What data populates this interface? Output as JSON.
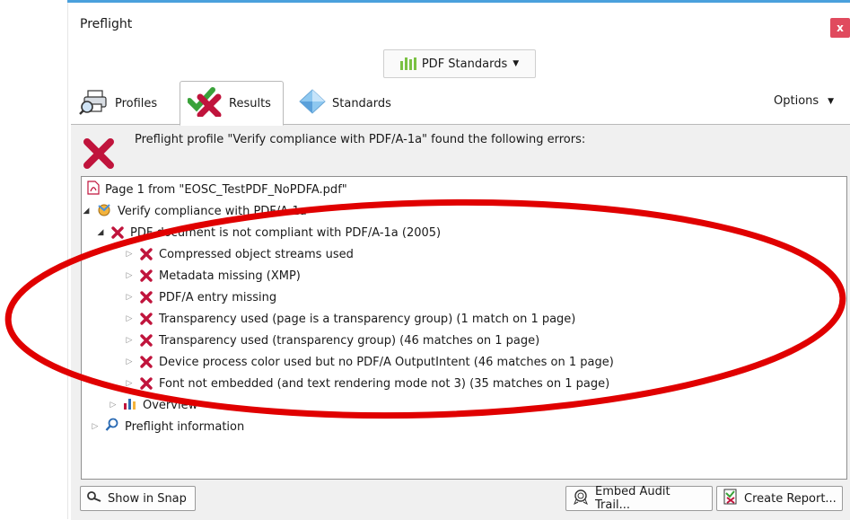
{
  "window": {
    "title": "Preflight",
    "close_label": "x"
  },
  "toolbar": {
    "standards_dropdown": "PDF Standards"
  },
  "tabs": [
    {
      "label": "Profiles",
      "icon": "printer-magnifier-icon"
    },
    {
      "label": "Results",
      "icon": "check-x-icon"
    },
    {
      "label": "Standards",
      "icon": "diamond-icon"
    }
  ],
  "options_label": "Options",
  "summary": {
    "text": "Preflight profile \"Verify compliance with PDF/A-1a\" found the following errors:"
  },
  "tree": {
    "page": "Page 1 from \"EOSC_TestPDF_NoPDFA.pdf\"",
    "profile": "Verify compliance with PDF/A-1a",
    "result": "PDF document is not compliant with PDF/A-1a (2005)",
    "errors": [
      "Compressed object streams used",
      "Metadata missing (XMP)",
      "PDF/A entry missing",
      "Transparency used (page is a transparency group) (1 match on 1 page)",
      "Transparency used (transparency group) (46 matches on 1 page)",
      "Device process color used but no PDF/A OutputIntent (46 matches on 1 page)",
      "Font not embedded (and text rendering mode not 3) (35 matches on 1 page)"
    ],
    "overview": "Overview",
    "info": "Preflight information"
  },
  "footer": {
    "snap": "Show in Snap",
    "embed": "Embed Audit Trail...",
    "report": "Create Report..."
  },
  "colors": {
    "error": "#c0143c",
    "annotation": "#e00000",
    "accent": "#4aa0dc"
  }
}
